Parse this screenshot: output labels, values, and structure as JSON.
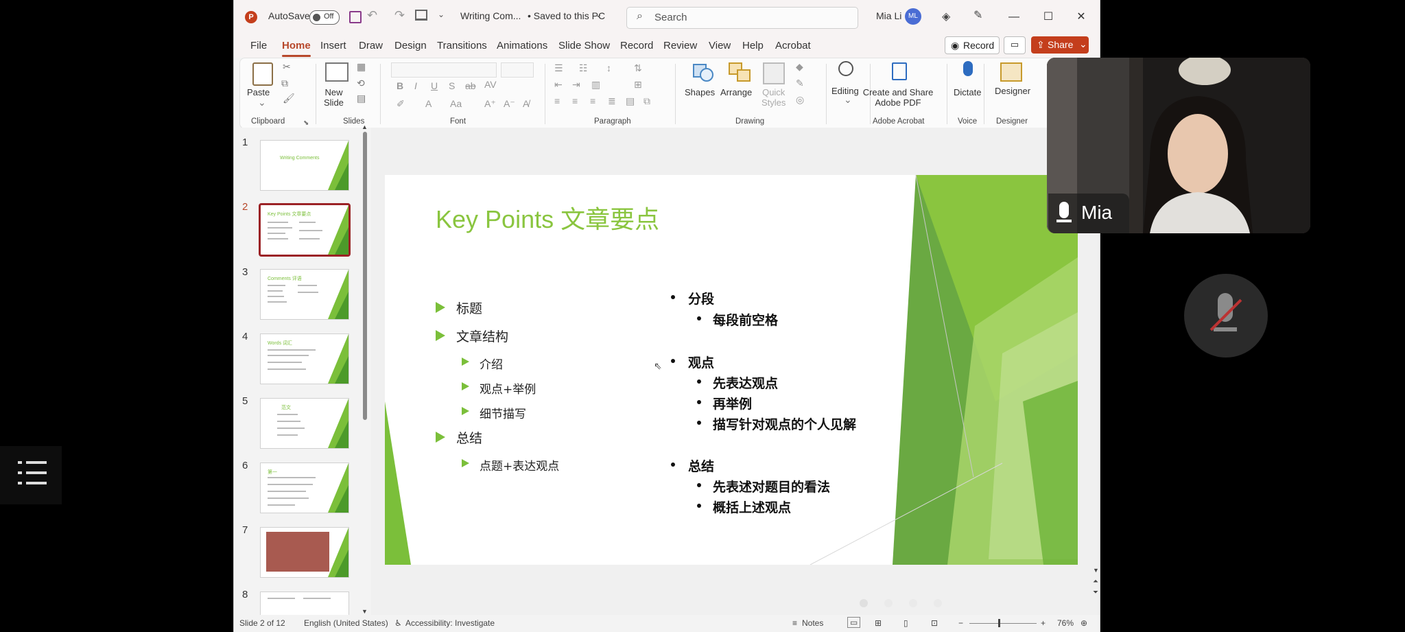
{
  "titlebar": {
    "autosave_label": "AutoSave",
    "autosave_state": "Off",
    "doc_title": "Writing Com...",
    "saved_status": "• Saved to this PC",
    "search_placeholder": "Search",
    "user_name": "Mia Li",
    "user_initials": "ML"
  },
  "tabs": [
    "File",
    "Home",
    "Insert",
    "Draw",
    "Design",
    "Transitions",
    "Animations",
    "Slide Show",
    "Record",
    "Review",
    "View",
    "Help",
    "Acrobat"
  ],
  "active_tab": "Home",
  "actions": {
    "record_label": "Record",
    "share_label": "Share"
  },
  "ribbon": {
    "clipboard": {
      "paste": "Paste",
      "label": "Clipboard"
    },
    "slides": {
      "new_slide_1": "New",
      "new_slide_2": "Slide",
      "label": "Slides"
    },
    "font": {
      "label": "Font"
    },
    "paragraph": {
      "label": "Paragraph"
    },
    "drawing": {
      "shapes": "Shapes",
      "arrange": "Arrange",
      "quick_styles_1": "Quick",
      "quick_styles_2": "Styles",
      "label": "Drawing"
    },
    "editing": {
      "label": "Editing"
    },
    "acrobat": {
      "create_1": "Create and Share",
      "create_2": "Adobe PDF",
      "label": "Adobe Acrobat"
    },
    "voice": {
      "dictate": "Dictate",
      "label": "Voice"
    },
    "designer": {
      "designer": "Designer",
      "label": "Designer"
    }
  },
  "thumbnails": {
    "numbers": [
      "1",
      "2",
      "3",
      "4",
      "5",
      "6",
      "7",
      "8"
    ],
    "titles": [
      "Writing Comments",
      "Key Points 文章要点",
      "Comments 评语",
      "Words 词汇",
      "范文",
      "第一",
      "",
      ""
    ],
    "selected": "2"
  },
  "slide": {
    "title": "Key Points 文章要点",
    "left_items": [
      {
        "text": "标题",
        "level": 1
      },
      {
        "text": "文章结构",
        "level": 1
      },
      {
        "text": "介绍",
        "level": 2
      },
      {
        "text": "观点+举例",
        "level": 2
      },
      {
        "text": "细节描写",
        "level": 2
      },
      {
        "text": "总结",
        "level": 1
      },
      {
        "text": "点题+表达观点",
        "level": 2
      }
    ],
    "right_items": [
      {
        "text": "分段",
        "level": 1
      },
      {
        "text": "每段前空格",
        "level": 2
      },
      {
        "text": "观点",
        "level": 1
      },
      {
        "text": "先表达观点",
        "level": 2
      },
      {
        "text": "再举例",
        "level": 2
      },
      {
        "text": "描写针对观点的个人见解",
        "level": 2
      },
      {
        "text": "总结",
        "level": 1
      },
      {
        "text": "先表述对题目的看法",
        "level": 2
      },
      {
        "text": "概括上述观点",
        "level": 2
      }
    ]
  },
  "statusbar": {
    "slide_info": "Slide 2 of 12",
    "language": "English (United States)",
    "accessibility": "Accessibility: Investigate",
    "notes": "Notes",
    "zoom": "76%"
  },
  "webcam": {
    "participant_name": "Mia"
  },
  "colors": {
    "accent": "#b7472a",
    "slide_green": "#8ac53f",
    "share": "#c43e1c"
  }
}
